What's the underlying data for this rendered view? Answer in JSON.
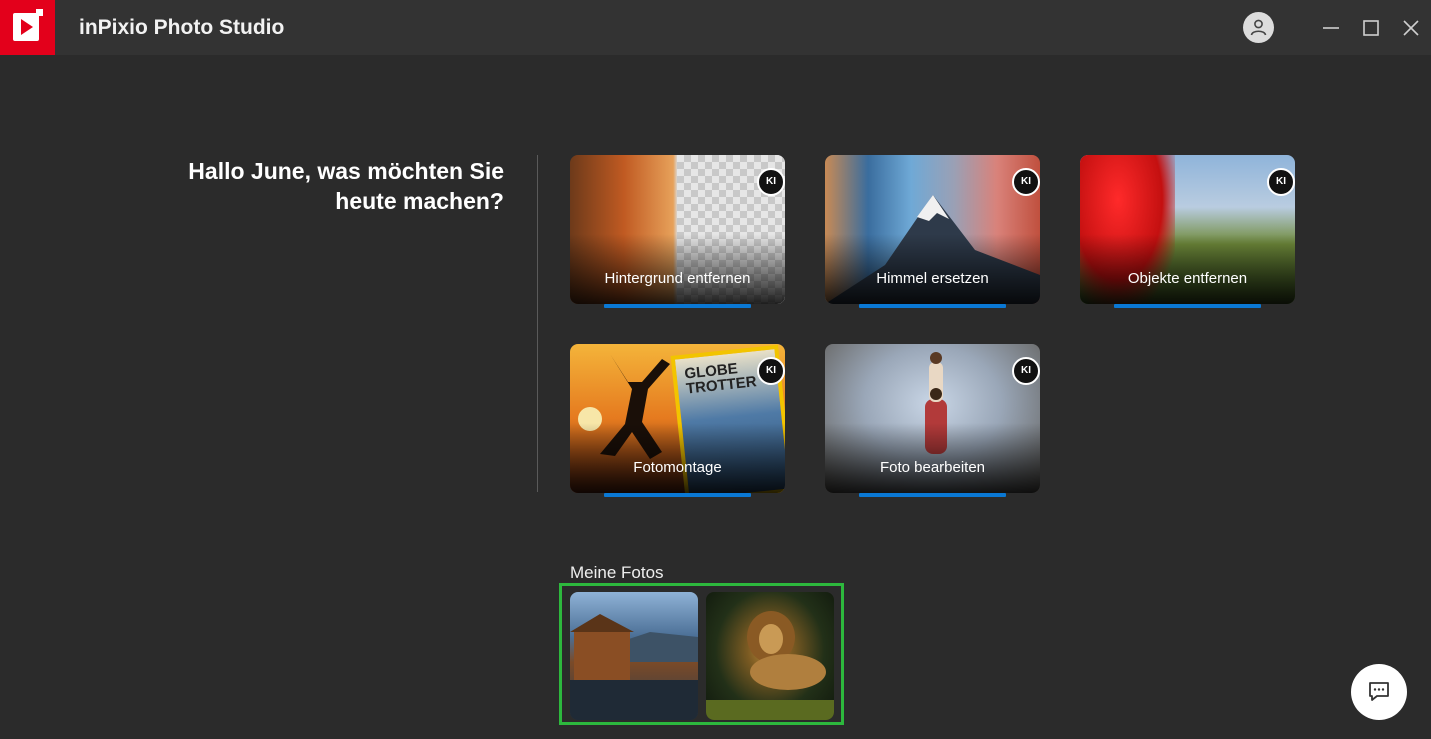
{
  "app": {
    "title": "inPixio Photo Studio",
    "brand_color": "#e3001b"
  },
  "window_controls": {
    "user_icon": "user-icon",
    "minimize_icon": "minimize-icon",
    "maximize_icon": "maximize-icon",
    "close_icon": "close-icon"
  },
  "greeting": "Hallo June, was möchten Sie heute machen?",
  "badge_text": "KI",
  "tools": [
    {
      "label": "Hintergrund entfernen",
      "badge": "KI"
    },
    {
      "label": "Himmel ersetzen",
      "badge": "KI"
    },
    {
      "label": "Objekte entfernen",
      "badge": "KI"
    },
    {
      "label": "Fotomontage",
      "badge": "KI",
      "magazine_title": "GLOBE TROTTER"
    },
    {
      "label": "Foto bearbeiten",
      "badge": "KI"
    }
  ],
  "my_photos": {
    "title": "Meine Fotos",
    "highlight_color": "#2db83d",
    "items": [
      {
        "description_icon": "boathouse-photo"
      },
      {
        "description_icon": "lion-photo"
      }
    ]
  },
  "chat": {
    "icon": "chat-icon"
  },
  "accent_color": "#0a78d4"
}
